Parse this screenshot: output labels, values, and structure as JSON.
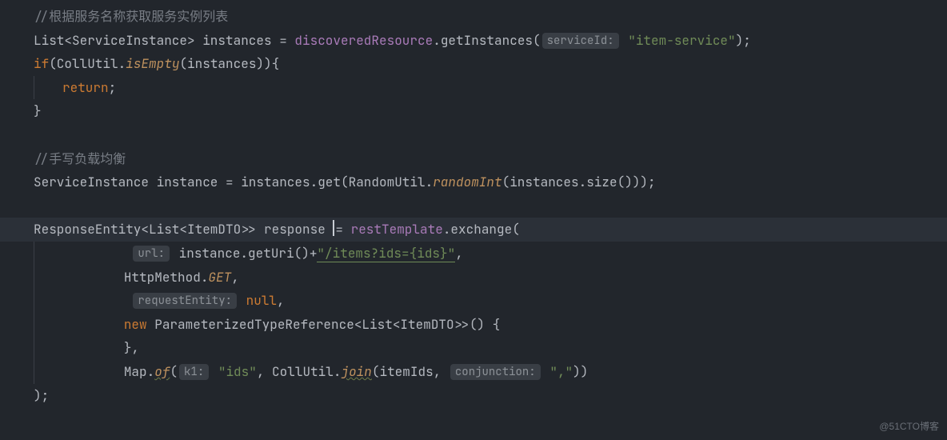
{
  "code": {
    "l1_comment": "//根据服务名称获取服务实例列表",
    "l2_a": "List<ServiceInstance> instances = ",
    "l2_field": "discoveredResource",
    "l2_b": ".getInstances(",
    "l2_hint": "serviceId:",
    "l2_c": " ",
    "l2_str": "\"item-service\"",
    "l2_d": ");",
    "l3_a": "if",
    "l3_b": "(CollUtil.",
    "l3_static": "isEmpty",
    "l3_c": "(instances)){",
    "l4_a": "return",
    "l4_b": ";",
    "l5_a": "}",
    "l7_comment": "//手写负载均衡",
    "l8_a": "ServiceInstance instance = instances.get(RandomUtil.",
    "l8_static": "randomInt",
    "l8_b": "(instances.size()));",
    "l10_a": "ResponseEntity<List<ItemDTO>> response ",
    "l10_eq": "= ",
    "l10_field": "restTemplate",
    "l10_b": ".exchange(",
    "l11_hint": "url:",
    "l11_a": " instance.getUri()+",
    "l11_str": "\"/items?ids={ids}\"",
    "l11_b": ",",
    "l12_a": "HttpMethod.",
    "l12_static": "GET",
    "l12_b": ",",
    "l13_hint": "requestEntity:",
    "l13_kw": " null",
    "l13_b": ",",
    "l14_kw": "new",
    "l14_a": " ParameterizedTypeReference<List<ItemDTO>>() {",
    "l15_a": "},",
    "l16_a": "Map.",
    "l16_static": "of",
    "l16_b": "(",
    "l16_hint": "k1:",
    "l16_c": " ",
    "l16_str1": "\"ids\"",
    "l16_d": ", CollUtil.",
    "l16_static2": "join",
    "l16_e": "(itemIds, ",
    "l16_hint2": "conjunction:",
    "l16_f": " ",
    "l16_str2": "\",\"",
    "l16_g": "))",
    "l17_a": ");"
  },
  "watermark": "@51CTO博客"
}
